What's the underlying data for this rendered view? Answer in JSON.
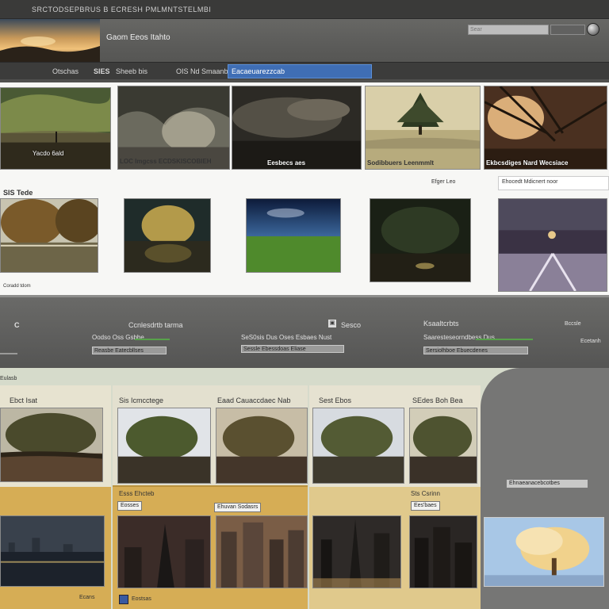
{
  "app_title": "SRCTODSEPBRUS B ECRESH PMLMNTSTELMBI",
  "gallery_title": "Gaom Eeos Itahto",
  "search": {
    "placeholder": "Sear",
    "extra_label": ""
  },
  "menu": {
    "items": [
      "Otschas",
      "SIES",
      "Sheeb bis",
      "OIS",
      "Nd Smaanb"
    ],
    "search_value": "Eacaeuarezzcab"
  },
  "top_gallery": {
    "row1": [
      {
        "caption": "Yacdo 6ald",
        "icon": "landscape-photo"
      },
      {
        "caption": "LOC Imgcss ECDSKISCOBIEH",
        "icon": "tree-tunnel-photo"
      },
      {
        "caption": "Eesbecs aes",
        "icon": "stormy-sky-photo"
      },
      {
        "caption": "Sodibbuers Leenmmlt",
        "icon": "lone-tree-photo"
      },
      {
        "caption": "Ekbcsdiges Nard Wecsiace",
        "icon": "branches-photo"
      }
    ],
    "row1_sub_captions": [
      "Efger Leo",
      "Ehocedt Mdicnert noor"
    ],
    "row2_label": "SIS Tede",
    "row2_footer": "Coradd tdom",
    "row2": [
      "lake-photo",
      "autumn-tree-photo",
      "starry-field-photo",
      "dark-forest-photo",
      "city-street-photo"
    ]
  },
  "toolbar": {
    "labels": [
      "Ccnlesdrtb tarma",
      "Sesco",
      "Ksaaltcrbts"
    ],
    "rows": [
      {
        "label": "Oodso Oss Gsbbe",
        "button": "Reasbe Eatecbllses"
      },
      {
        "label": "SeS0sis Dus Oses Esbaes Nust",
        "button": "Sessle Ebessdoas Eliase"
      },
      {
        "label": "Saaresteseorndbess Dus",
        "button": "Sersiolhboe Ebuecdenes"
      }
    ],
    "right_items": [
      "Bccsle",
      "Ecetanh"
    ]
  },
  "lower": {
    "side_label": "Eulasb",
    "tab_labels": [
      "Ebct Isat",
      "Sis Icmcctege",
      "Eaad Cauaccdaec Nab",
      "Sest Ebos",
      "SEdes Boh Bea"
    ],
    "panel_title": "Esss Ehcteb",
    "tag_buttons": [
      "Eosses",
      "Ehuvan Sodasrs"
    ],
    "tag_label_right": "Sts Csrinn",
    "tag_button_right": "Ees'baes",
    "right_panel_button": "Ehnaeanacebcotbes",
    "bottom_left": "Ecans",
    "bottom_right": "Eostsas"
  },
  "colors": {
    "header": "#5a5a58",
    "menu_highlight": "#3f6eb5",
    "panel_gold": "#d6ad55",
    "panel_green": "#d6dbcb"
  }
}
